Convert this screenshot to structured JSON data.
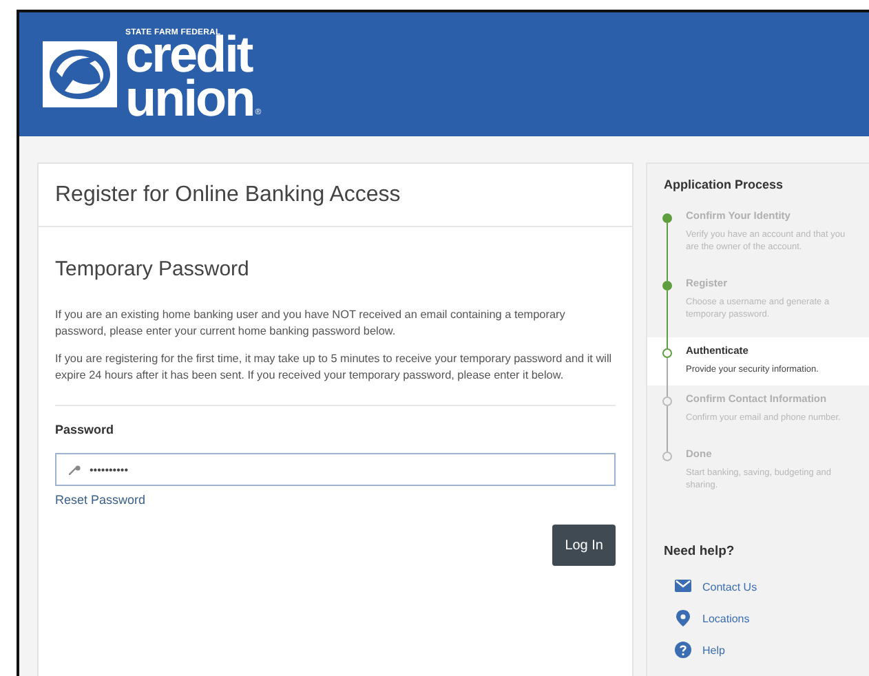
{
  "logo": {
    "tagline": "STATE FARM FEDERAL",
    "line_1": "credit",
    "line_2": "union",
    "mark": "®"
  },
  "page_title": "Register for Online Banking Access",
  "section_title": "Temporary Password",
  "paragraphs": [
    "If you are an existing home banking user and you have NOT received an email containing a temporary password, please enter your current home banking password below.",
    "If you are registering for the first time, it may take up to 5 minutes to receive your temporary password and it will expire 24 hours after it has been sent. If you received your temporary password, please enter it below."
  ],
  "password": {
    "label": "Password",
    "value": "••••••••••"
  },
  "reset_link": "Reset Password",
  "login_button": "Log In",
  "process": {
    "title": "Application Process",
    "steps": [
      {
        "title": "Confirm Your Identity",
        "description": "Verify you have an account and that you are the owner of the account.",
        "completed": true,
        "selected": false
      },
      {
        "title": "Register",
        "description": "Choose a username and generate a temporary password.",
        "completed": true,
        "selected": false
      },
      {
        "title": "Authenticate",
        "description": "Provide your security information.",
        "completed": false,
        "selected": true
      },
      {
        "title": "Confirm Contact Information",
        "description": "Confirm your email and phone number.",
        "completed": false,
        "selected": false
      },
      {
        "title": "Done",
        "description": "Start banking, saving, budgeting and sharing.",
        "completed": false,
        "selected": false
      }
    ]
  },
  "help": {
    "title": "Need help?",
    "links": [
      {
        "label": "Contact Us",
        "kind": "mail"
      },
      {
        "label": "Locations",
        "kind": "pin"
      },
      {
        "label": "Help",
        "kind": "question"
      }
    ]
  }
}
